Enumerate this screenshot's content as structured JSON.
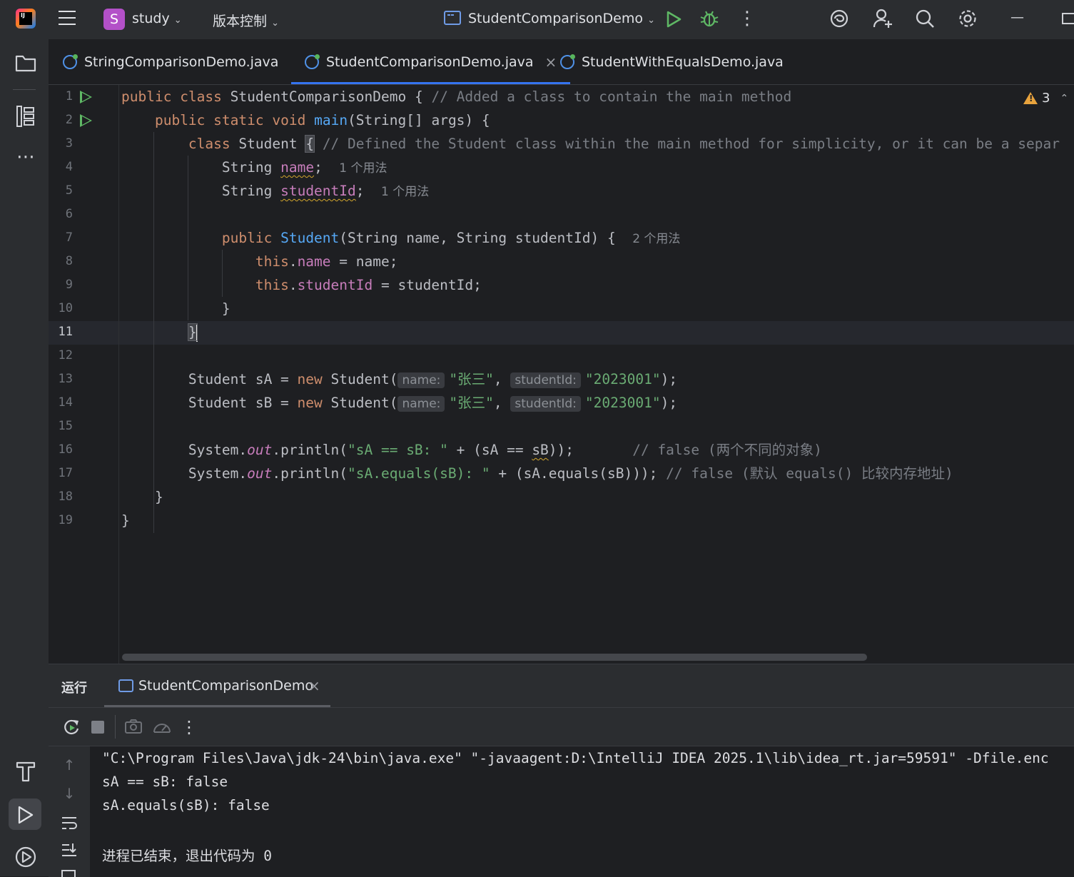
{
  "titlebar": {
    "project_badge": "S",
    "project_name": "study",
    "vcs_label": "版本控制",
    "run_config": "StudentComparisonDemo",
    "minimize": "—"
  },
  "tabs": [
    {
      "label": "StringComparisonDemo.java",
      "active": false
    },
    {
      "label": "StudentComparisonDemo.java",
      "active": true,
      "close": "×"
    },
    {
      "label": "StudentWithEqualsDemo.java",
      "active": false
    }
  ],
  "editor": {
    "warning_count": "3",
    "current_line": 11,
    "line_numbers": [
      "1",
      "2",
      "3",
      "4",
      "5",
      "6",
      "7",
      "8",
      "9",
      "10",
      "11",
      "12",
      "13",
      "14",
      "15",
      "16",
      "17",
      "18",
      "19"
    ],
    "code": {
      "l1_kw1": "public",
      "l1_kw2": "class",
      "l1_name": "StudentComparisonDemo",
      "l1_brace": "{",
      "l1_comment": "// Added a class to contain the main method",
      "l2_kw1": "public",
      "l2_kw2": "static",
      "l2_kw3": "void",
      "l2_fn": "main",
      "l2_rest": "(String[] args) {",
      "l3_kw": "class",
      "l3_name": "Student",
      "l3_brace": "{",
      "l3_comment": "// Defined the Student class within the main method for simplicity, or it can be a separ",
      "l4_type": "String",
      "l4_field": "name",
      "l4_semi": ";",
      "l4_hint": "1 个用法",
      "l5_type": "String",
      "l5_field": "studentId",
      "l5_semi": ";",
      "l5_hint": "1 个用法",
      "l7_kw": "public",
      "l7_fn": "Student",
      "l7_rest": "(String name, String studentId) {",
      "l7_hint": "2 个用法",
      "l8_this": "this",
      "l8_dot": ".",
      "l8_field": "name",
      "l8_rest": " = name;",
      "l9_this": "this",
      "l9_dot": ".",
      "l9_field": "studentId",
      "l9_rest": " = studentId;",
      "l10": "}",
      "l11": "}",
      "l13_a": "Student sA = ",
      "l13_new": "new",
      "l13_b": " Student(",
      "l13_p1": "name:",
      "l13_s1": "\"张三\"",
      "l13_c": ", ",
      "l13_p2": "studentId:",
      "l13_s2": "\"2023001\"",
      "l13_end": ");",
      "l14_a": "Student sB = ",
      "l14_new": "new",
      "l14_b": " Student(",
      "l14_p1": "name:",
      "l14_s1": "\"张三\"",
      "l14_c": ", ",
      "l14_p2": "studentId:",
      "l14_s2": "\"2023001\"",
      "l14_end": ");",
      "l16_a": "System.",
      "l16_out": "out",
      "l16_b": ".println(",
      "l16_str": "\"sA == sB: \"",
      "l16_c": " + (sA == ",
      "l16_sb": "sB",
      "l16_d": "));",
      "l16_comment": "// false (两个不同的对象)",
      "l17_a": "System.",
      "l17_out": "out",
      "l17_b": ".println(",
      "l17_str": "\"sA.equals(sB): \"",
      "l17_c": " + (sA.equals(sB)));",
      "l17_comment": "// false (默认 equals() 比较内存地址)",
      "l18": "}",
      "l19": "}"
    }
  },
  "run_panel": {
    "title": "运行",
    "tab_label": "StudentComparisonDemo",
    "tab_close": "×",
    "console": [
      "\"C:\\Program Files\\Java\\jdk-24\\bin\\java.exe\" \"-javaagent:D:\\IntelliJ IDEA 2025.1\\lib\\idea_rt.jar=59591\" -Dfile.enc",
      "sA == sB: false",
      "sA.equals(sB): false",
      "",
      "进程已结束，退出代码为 0"
    ]
  },
  "icons": {
    "logo": "intellij-logo-icon",
    "menu": "hamburger-menu-icon",
    "run": "run-icon",
    "debug": "debug-icon",
    "more": "more-vertical-icon",
    "ai": "ai-assistant-icon",
    "add_user": "add-user-icon",
    "search": "search-icon",
    "settings": "gear-icon",
    "project": "folder-icon",
    "structure": "structure-icon",
    "build": "hammer-icon",
    "run_tool": "run-tool-icon",
    "services": "services-icon",
    "rerun": "rerun-icon",
    "stop": "stop-icon",
    "snapshot": "camera-icon",
    "profiler": "profiler-icon",
    "up": "arrow-up-icon",
    "down": "arrow-down-icon",
    "soft_wrap": "soft-wrap-icon",
    "scroll_end": "scroll-to-end-icon",
    "print": "print-icon"
  },
  "colors": {
    "accent": "#3574f0",
    "run_green": "#5fb865",
    "keyword": "#cf8e6d",
    "function": "#56a8f5",
    "string": "#6aab73",
    "field": "#c77dbb",
    "comment": "#7a7e85",
    "warning": "#e8a33d"
  }
}
